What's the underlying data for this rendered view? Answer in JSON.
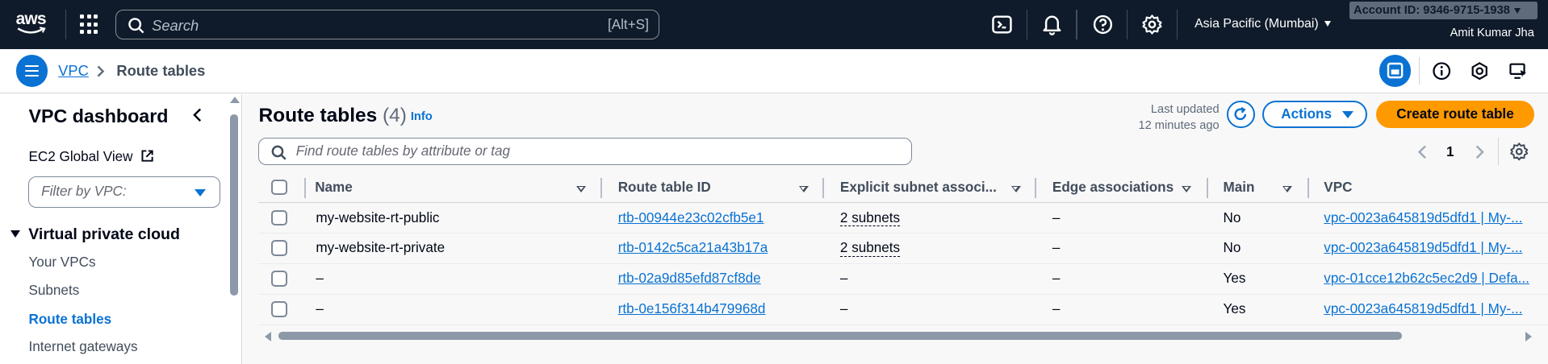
{
  "topnav": {
    "logo_text": "aws",
    "search_placeholder": "Search",
    "search_shortcut": "[Alt+S]",
    "region": "Asia Pacific (Mumbai)",
    "account": "Account ID: 9346-9715-1938",
    "user": "Amit Kumar Jha",
    "icons": [
      "cloudshell-icon",
      "notifications-icon",
      "help-icon",
      "settings-icon"
    ]
  },
  "breadcrumb": {
    "items": [
      "VPC",
      "Route tables"
    ]
  },
  "sidebar": {
    "title": "VPC dashboard",
    "ec2_link": "EC2 Global View",
    "filter_placeholder": "Filter by VPC:",
    "section": "Virtual private cloud",
    "items": [
      "Your VPCs",
      "Subnets",
      "Route tables",
      "Internet gateways"
    ],
    "active_item": "Route tables"
  },
  "main": {
    "title": "Route tables",
    "count": "(4)",
    "info": "Info",
    "last_updated_line1": "Last updated",
    "last_updated_line2": "12 minutes ago",
    "actions_label": "Actions",
    "create_label": "Create route table",
    "search_placeholder": "Find route tables by attribute or tag",
    "page": "1",
    "columns": [
      "Name",
      "Route table ID",
      "Explicit subnet associ...",
      "Edge associations",
      "Main",
      "VPC"
    ],
    "rows": [
      {
        "name": "my-website-rt-public",
        "id": "rtb-00944e23c02cfb5e1",
        "subnets": "2 subnets",
        "edge": "–",
        "main": "No",
        "vpc": "vpc-0023a645819d5dfd1 | My-..."
      },
      {
        "name": "my-website-rt-private",
        "id": "rtb-0142c5ca21a43b17a",
        "subnets": "2 subnets",
        "edge": "–",
        "main": "No",
        "vpc": "vpc-0023a645819d5dfd1 | My-..."
      },
      {
        "name": "–",
        "id": "rtb-02a9d85efd87cf8de",
        "subnets": "–",
        "edge": "–",
        "main": "Yes",
        "vpc": "vpc-01cce12b62c5ec2d9 | Defa..."
      },
      {
        "name": "–",
        "id": "rtb-0e156f314b479968d",
        "subnets": "–",
        "edge": "–",
        "main": "Yes",
        "vpc": "vpc-0023a645819d5dfd1 | My-..."
      }
    ]
  },
  "colors": {
    "nav_bg": "#0f1b2a",
    "link": "#0972d3",
    "primary_button": "#ff9900"
  }
}
